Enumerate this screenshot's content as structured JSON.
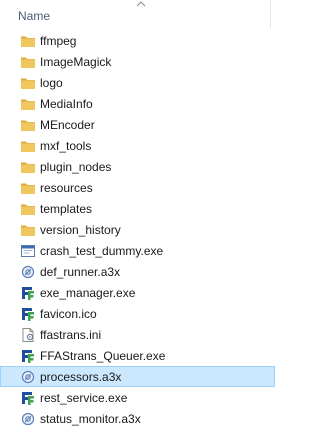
{
  "header": {
    "name_label": "Name"
  },
  "items": [
    {
      "label": "ffmpeg",
      "icon": "folder-icon",
      "selected": false
    },
    {
      "label": "ImageMagick",
      "icon": "folder-icon",
      "selected": false
    },
    {
      "label": "logo",
      "icon": "folder-icon",
      "selected": false
    },
    {
      "label": "MediaInfo",
      "icon": "folder-icon",
      "selected": false
    },
    {
      "label": "MEncoder",
      "icon": "folder-icon",
      "selected": false
    },
    {
      "label": "mxf_tools",
      "icon": "folder-icon",
      "selected": false
    },
    {
      "label": "plugin_nodes",
      "icon": "folder-icon",
      "selected": false
    },
    {
      "label": "resources",
      "icon": "folder-icon",
      "selected": false
    },
    {
      "label": "templates",
      "icon": "folder-icon",
      "selected": false
    },
    {
      "label": "version_history",
      "icon": "folder-icon",
      "selected": false
    },
    {
      "label": "crash_test_dummy.exe",
      "icon": "exe-window-icon",
      "selected": false
    },
    {
      "label": "def_runner.a3x",
      "icon": "a3x-script-icon",
      "selected": false
    },
    {
      "label": "exe_manager.exe",
      "icon": "ffastrans-app-icon",
      "selected": false
    },
    {
      "label": "favicon.ico",
      "icon": "ffastrans-app-icon",
      "selected": false
    },
    {
      "label": "ffastrans.ini",
      "icon": "ini-file-icon",
      "selected": false
    },
    {
      "label": "FFAStrans_Queuer.exe",
      "icon": "ffastrans-app-icon",
      "selected": false
    },
    {
      "label": "processors.a3x",
      "icon": "a3x-script-icon",
      "selected": true
    },
    {
      "label": "rest_service.exe",
      "icon": "ffastrans-app-icon",
      "selected": false
    },
    {
      "label": "status_monitor.a3x",
      "icon": "a3x-script-icon",
      "selected": false
    }
  ],
  "colors": {
    "folder": "#e8b84a",
    "selection_bg": "#cce8ff",
    "selection_border": "#99d1ff",
    "header_text": "#4c607a"
  }
}
